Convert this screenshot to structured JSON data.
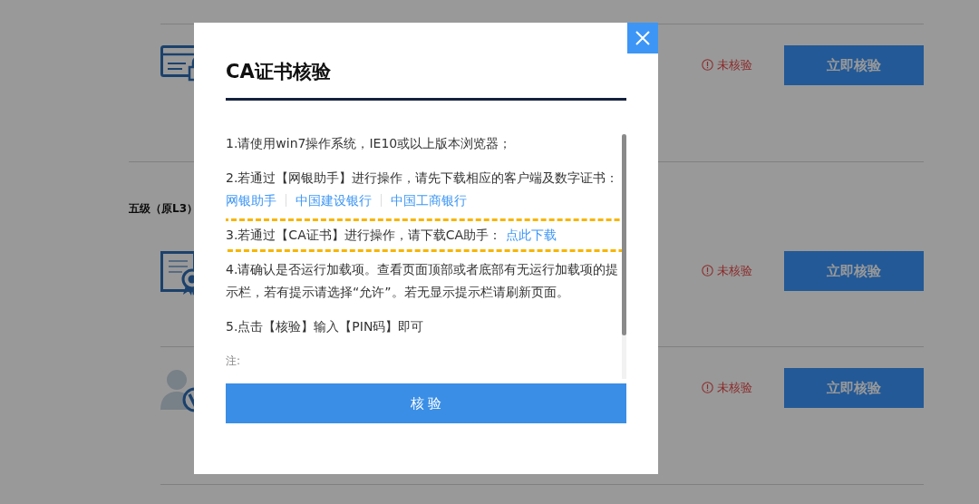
{
  "entries": [
    {
      "kind": "lock-card",
      "status": "未核验",
      "button": "立即核验"
    },
    {
      "kind": "heading",
      "text": "五级（原L3）"
    },
    {
      "kind": "certificate",
      "status": "未核验",
      "button": "立即核验"
    },
    {
      "kind": "user",
      "status": "未核验",
      "button": "立即核验"
    }
  ],
  "dialog": {
    "title": "CA证书核验",
    "steps": [
      {
        "text": "1.请使用win7操作系统，IE10或以上版本浏览器；",
        "highlighted": false
      },
      {
        "text": "2.若通过【网银助手】进行操作，请先下载相应的客户端及数字证书：",
        "links": [
          "网银助手",
          "中国建设银行",
          "中国工商银行"
        ],
        "highlighted": false
      },
      {
        "text": "3.若通过【CA证书】进行操作，请下载CA助手：",
        "links": [
          "点此下载"
        ],
        "highlighted": true
      },
      {
        "text": "4.请确认是否运行加载项。查看页面顶部或者底部有无运行加载项的提示栏，若有提示请选择“允许”。若无显示提示栏请刷新页面。",
        "highlighted": false
      },
      {
        "text": "5.点击【核验】输入【PIN码】即可",
        "highlighted": false
      }
    ],
    "note": "注:",
    "button": "核 验"
  }
}
